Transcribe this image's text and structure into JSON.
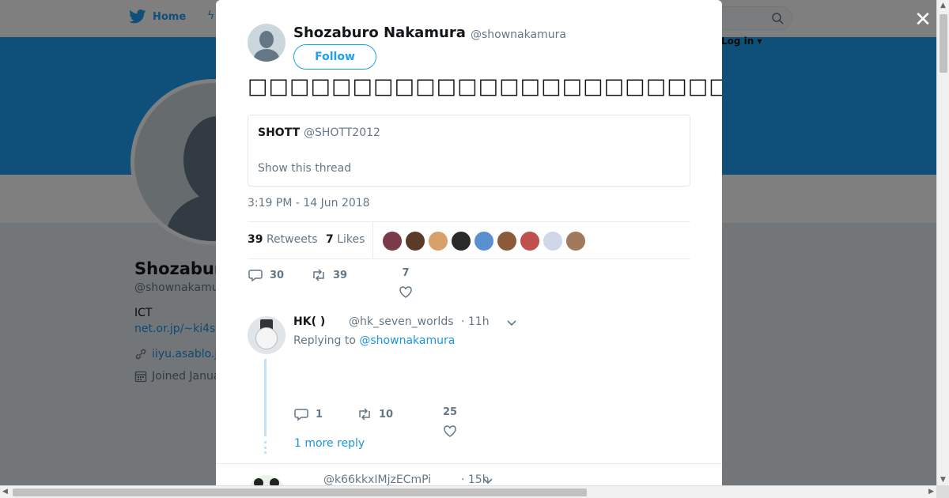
{
  "background": {
    "nav_home": "Home",
    "login_text": "Log in ▾",
    "profile_name": "Shozabur",
    "profile_handle": "@shownakamu",
    "bio": "ICT",
    "bio_link": "net.or.jp/~ki4s",
    "website": "iiyu.asablo.j",
    "joined": "Joined Janua"
  },
  "modal": {
    "author_name": "Shozaburo Nakamura",
    "author_handle": "@shownakamura",
    "follow_label": "Follow",
    "tweet_text": "□□□□□□□□□□□□□□□□□□□□□□□□□□□□□□□□□□□□□□□□□□□□□□□□□□",
    "quote": {
      "name": "SHOTT",
      "handle": "@SHOTT2012",
      "show_thread": "Show this thread"
    },
    "timestamp": "3:19 PM - 14 Jun 2018",
    "stats": {
      "retweets_count": "39",
      "retweets_label": "Retweets",
      "likes_count": "7",
      "likes_label": "Likes",
      "liker_colors": [
        "#7a3a4a",
        "#5b3a2a",
        "#d9a06b",
        "#2a2a2a",
        "#5a8fd0",
        "#8a5a3a",
        "#c0504d",
        "#cfd8e8",
        "#a07a5a"
      ]
    },
    "actions": {
      "replies": "30",
      "retweets": "39",
      "likes": "7"
    },
    "reply": {
      "name": "HK( )",
      "handle": "@hk_seven_worlds",
      "time": "· 11h",
      "replying_prefix": "Replying to",
      "replying_to": "@shownakamura",
      "replies": "1",
      "retweets": "10",
      "likes": "25",
      "more_replies": "1 more reply"
    },
    "reply2": {
      "handle": "@k66kkxIMjzECmPi",
      "time": "· 15h"
    }
  },
  "colors": {
    "brand": "#1da1f2",
    "link": "#1b95e0",
    "muted": "#657786"
  }
}
